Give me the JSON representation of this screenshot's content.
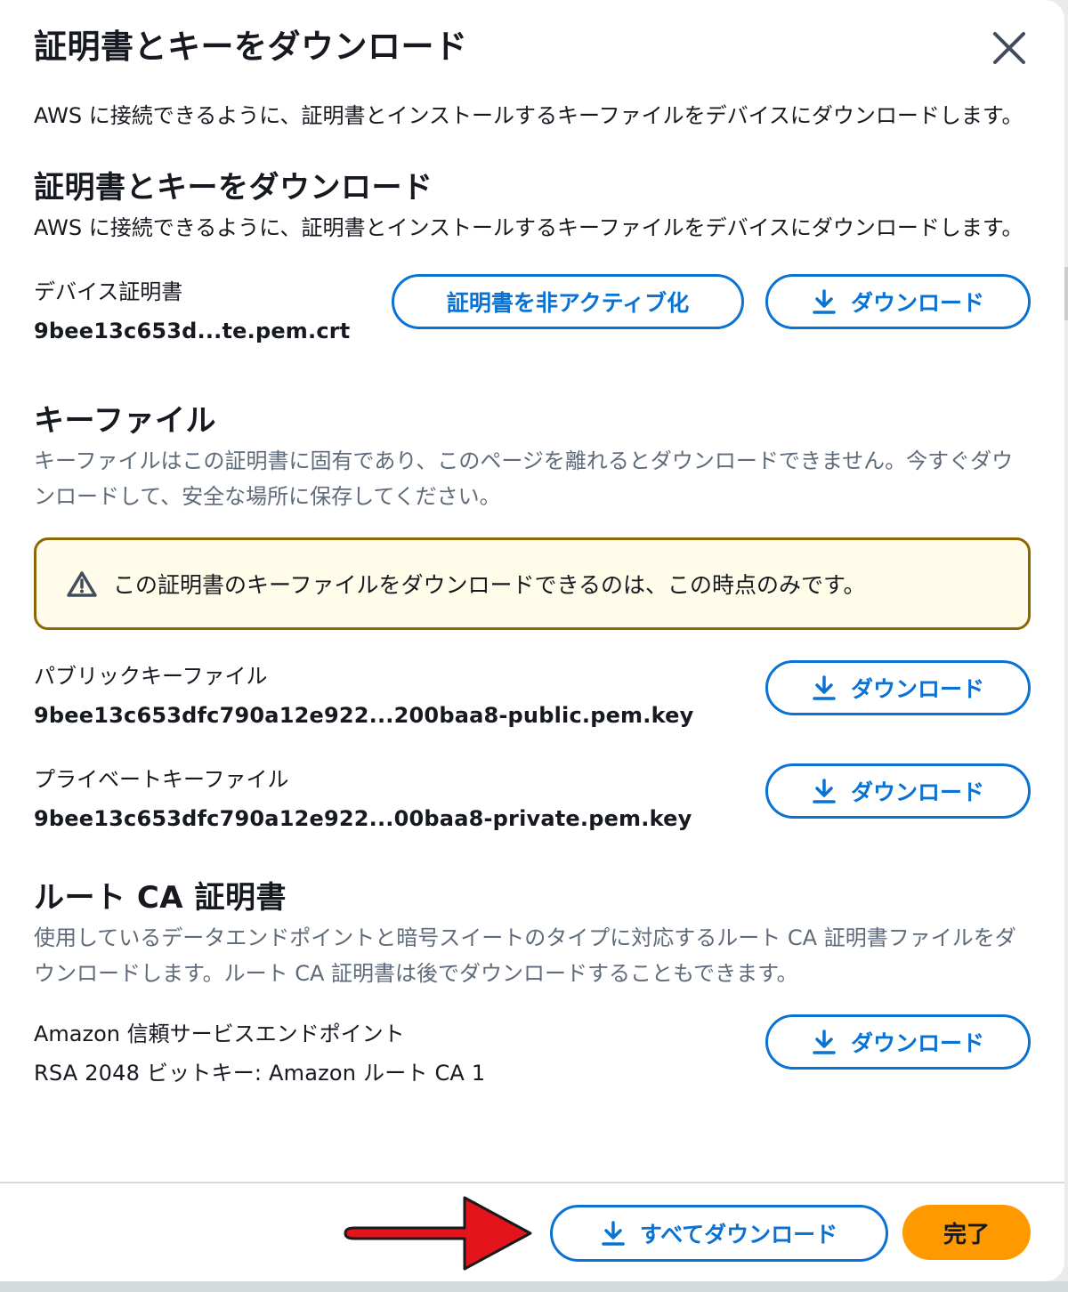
{
  "modal": {
    "title": "証明書とキーをダウンロード",
    "intro": "AWS に接続できるように、証明書とインストールするキーファイルをデバイスにダウンロードします。"
  },
  "cert_section": {
    "title": "証明書とキーをダウンロード",
    "description": "AWS に接続できるように、証明書とインストールするキーファイルをデバイスにダウンロードします。",
    "device_cert_label": "デバイス証明書",
    "device_cert_file": "9bee13c653d...te.pem.crt",
    "deactivate_label": "証明書を非アクティブ化",
    "download_label": "ダウンロード"
  },
  "key_section": {
    "title": "キーファイル",
    "description": "キーファイルはこの証明書に固有であり、このページを離れるとダウンロードできません。今すぐダウンロードして、安全な場所に保存してください。",
    "warning": "この証明書のキーファイルをダウンロードできるのは、この時点のみです。",
    "public_label": "パブリックキーファイル",
    "public_file": "9bee13c653dfc790a12e922...200baa8-public.pem.key",
    "private_label": "プライベートキーファイル",
    "private_file": "9bee13c653dfc790a12e922...00baa8-private.pem.key",
    "download_label": "ダウンロード"
  },
  "root_section": {
    "title": "ルート CA 証明書",
    "description": "使用しているデータエンドポイントと暗号スイートのタイプに対応するルート CA 証明書ファイルをダウンロードします。ルート CA 証明書は後でダウンロードすることもできます。",
    "endpoint_label": "Amazon 信頼サービスエンドポイント",
    "endpoint_file": "RSA 2048 ビットキー: Amazon ルート CA 1",
    "download_label": "ダウンロード"
  },
  "footer": {
    "download_all_label": "すべてダウンロード",
    "done_label": "完了"
  },
  "colors": {
    "primary": "#0972d3",
    "accent": "#ff9900",
    "warning_border": "#8d6605",
    "warning_bg": "#fffce9",
    "annotation_arrow": "#e3141b"
  },
  "icons": {
    "close": "close-icon",
    "download": "download-icon",
    "warning": "warning-icon",
    "annotation": "red-arrow-icon"
  }
}
